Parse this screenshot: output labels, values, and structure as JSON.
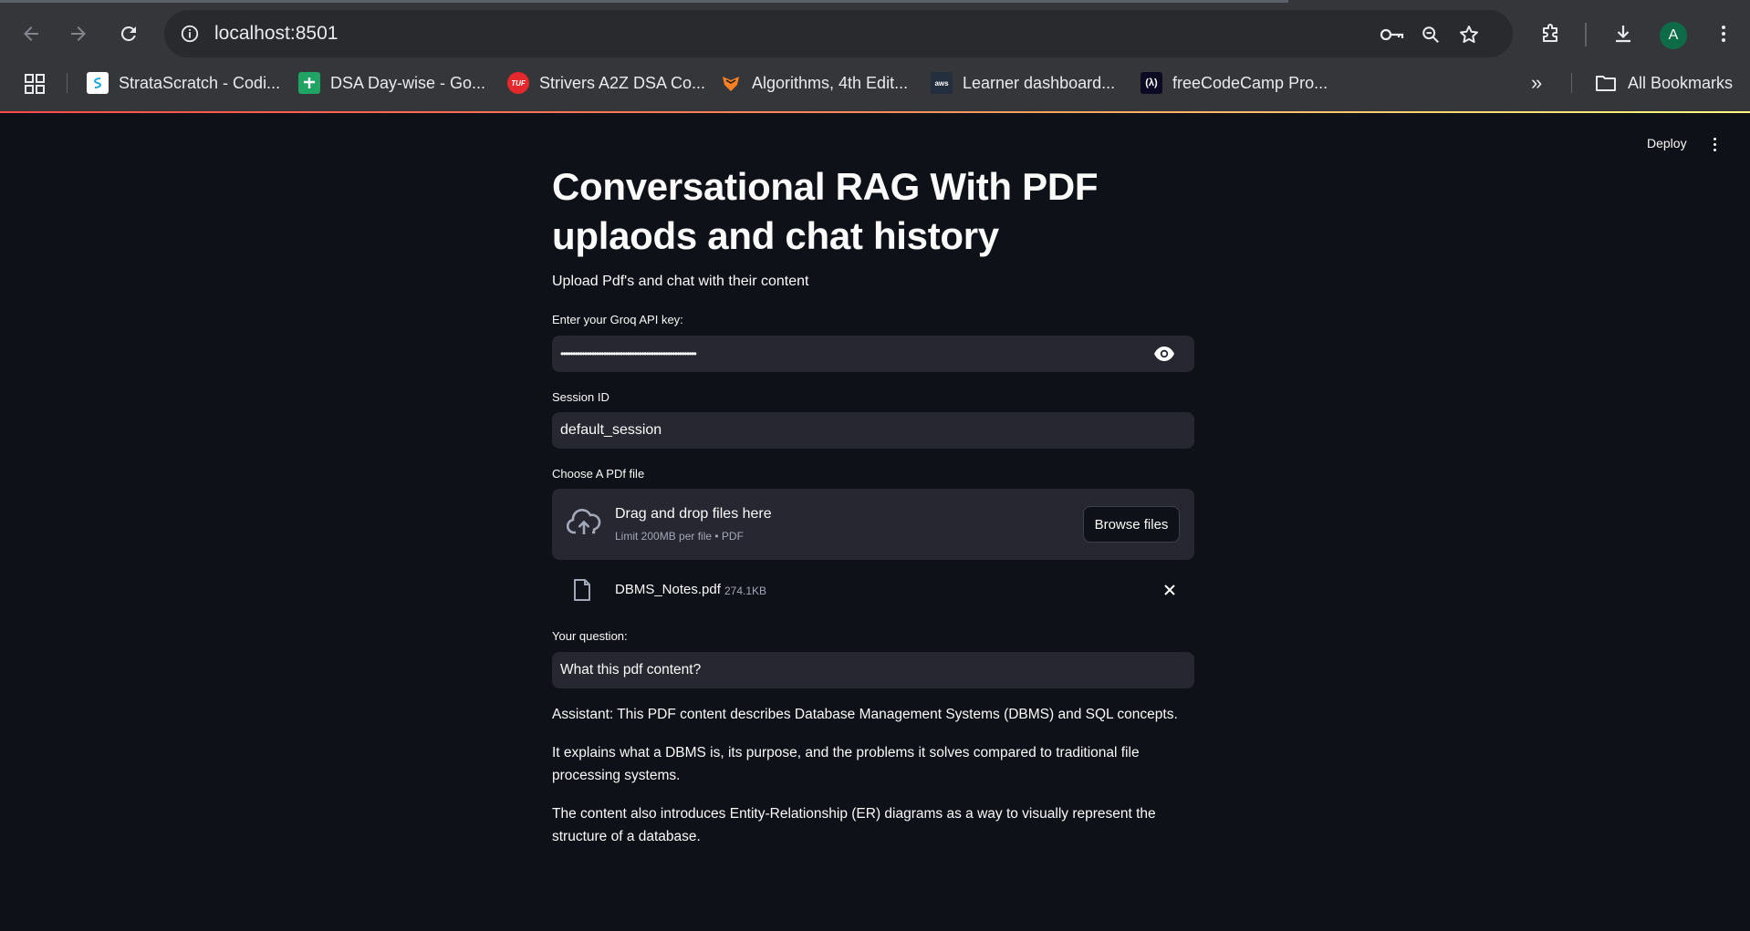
{
  "browser": {
    "url": "localhost:8501",
    "avatar_letter": "A",
    "bookmarks": [
      {
        "label": "StrataScratch - Codi...",
        "icon": "stratascratch-icon"
      },
      {
        "label": "DSA Day-wise - Go...",
        "icon": "google-sheets-icon"
      },
      {
        "label": "Strivers A2Z DSA Co...",
        "icon": "tuf-icon"
      },
      {
        "label": "Algorithms, 4th Edit...",
        "icon": "princeton-icon"
      },
      {
        "label": "Learner dashboard...",
        "icon": "aws-icon"
      },
      {
        "label": "freeCodeCamp Pro...",
        "icon": "freecodecamp-icon"
      }
    ],
    "all_bookmarks_label": "All Bookmarks",
    "more_label": "»"
  },
  "app": {
    "deploy_label": "Deploy",
    "title": "Conversational RAG With PDF uplaods and chat history",
    "subtitle": "Upload Pdf's and chat with their content",
    "api_key": {
      "label": "Enter your Groq API key:",
      "masked_value": "•••••••••••••••••••••••••••••••••••••••••••••••••••••••••"
    },
    "session": {
      "label": "Session ID",
      "value": "default_session"
    },
    "uploader": {
      "label": "Choose A PDf file",
      "drop_title": "Drag and drop files here",
      "drop_subtitle": "Limit 200MB per file • PDF",
      "browse_label": "Browse files"
    },
    "uploaded_file": {
      "name": "DBMS_Notes.pdf",
      "size": "274.1KB"
    },
    "question": {
      "label": "Your question:",
      "value": "What this pdf content?"
    },
    "answer": [
      "Assistant: This PDF content describes Database Management Systems (DBMS) and SQL concepts.",
      "It explains what a DBMS is, its purpose, and the problems it solves compared to traditional file processing systems.",
      "The content also introduces Entity-Relationship (ER) diagrams as a way to visually represent the structure of a database."
    ]
  },
  "colors": {
    "app_background": "#0e1117",
    "input_background": "#262730",
    "text": "#fafafa",
    "chrome_background": "#35363a"
  }
}
